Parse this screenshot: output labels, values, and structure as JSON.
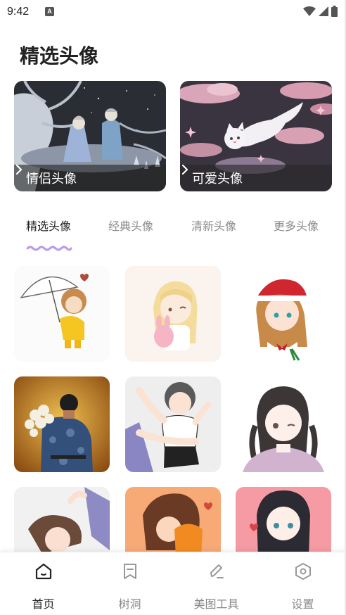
{
  "status_bar": {
    "time": "9:42",
    "notification_icon": "A"
  },
  "page": {
    "title": "精选头像"
  },
  "banners": [
    {
      "label": "情侣头像",
      "icon": "chevron-right-icon"
    },
    {
      "label": "可爱头像",
      "icon": "chevron-right-icon"
    }
  ],
  "tabs": [
    {
      "label": "精选头像",
      "active": true
    },
    {
      "label": "经典头像",
      "active": false
    },
    {
      "label": "清新头像",
      "active": false
    },
    {
      "label": "更多头像",
      "active": false
    }
  ],
  "grid": {
    "items": [
      {
        "name": "avatar-umbrella-child"
      },
      {
        "name": "avatar-blonde-girl-bunny"
      },
      {
        "name": "avatar-christmas-girl"
      },
      {
        "name": "avatar-man-flowers"
      },
      {
        "name": "avatar-hugging-couple"
      },
      {
        "name": "avatar-winking-girl"
      },
      {
        "name": "avatar-sleeping-girl"
      },
      {
        "name": "avatar-girl-cat"
      },
      {
        "name": "avatar-braided-girl"
      }
    ]
  },
  "bottom_nav": [
    {
      "label": "首页",
      "icon": "home-icon",
      "active": true
    },
    {
      "label": "树洞",
      "icon": "bookmark-icon",
      "active": false
    },
    {
      "label": "美图工具",
      "icon": "pen-icon",
      "active": false
    },
    {
      "label": "设置",
      "icon": "settings-hexagon-icon",
      "active": false
    }
  ],
  "colors": {
    "accent_wave": "#b89ae8",
    "nav_active": "#222222",
    "nav_inactive": "#888888"
  }
}
